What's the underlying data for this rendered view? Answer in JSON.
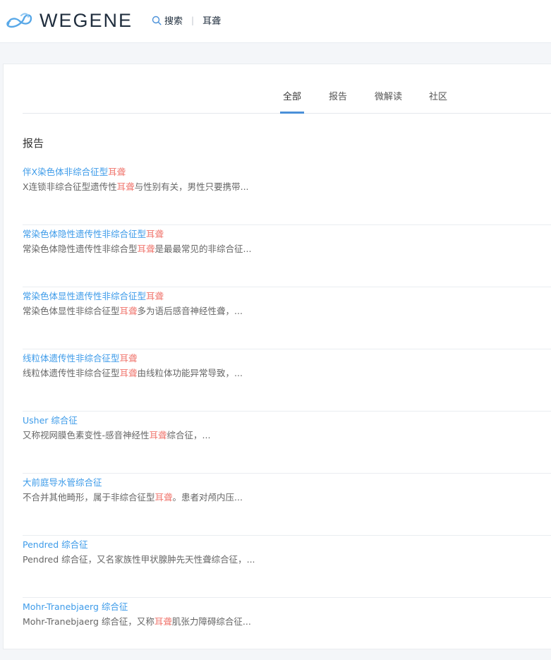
{
  "header": {
    "logo_text": "WEGENE",
    "search_label": "搜索",
    "separator": "|",
    "query": "耳聋"
  },
  "tabs": [
    {
      "label": "全部",
      "active": true
    },
    {
      "label": "报告",
      "active": false
    },
    {
      "label": "微解读",
      "active": false
    },
    {
      "label": "社区",
      "active": false
    }
  ],
  "section_title": "报告",
  "results": [
    {
      "title_pre": "伴X染色体非综合征型",
      "title_hl": "耳聋",
      "title_post": "",
      "desc_pre": "X连锁非综合征型遗传性",
      "desc_hl": "耳聋",
      "desc_post": "与性别有关，男性只要携带..."
    },
    {
      "title_pre": "常染色体隐性遗传性非综合征型",
      "title_hl": "耳聋",
      "title_post": "",
      "desc_pre": "常染色体隐性遗传性非综合型",
      "desc_hl": "耳聋",
      "desc_post": "是最最常见的非综合征..."
    },
    {
      "title_pre": "常染色体显性遗传性非综合征型",
      "title_hl": "耳聋",
      "title_post": "",
      "desc_pre": "常染色体显性非综合征型",
      "desc_hl": "耳聋",
      "desc_post": "多为语后感音神经性聋，..."
    },
    {
      "title_pre": "线粒体遗传性非综合征型",
      "title_hl": "耳聋",
      "title_post": "",
      "desc_pre": "线粒体遗传性非综合征型",
      "desc_hl": "耳聋",
      "desc_post": "由线粒体功能异常导致，..."
    },
    {
      "title_pre": "Usher 综合征",
      "title_hl": "",
      "title_post": "",
      "desc_pre": "又称视网膜色素变性-感音神经性",
      "desc_hl": "耳聋",
      "desc_post": "综合征，..."
    },
    {
      "title_pre": "大前庭导水管综合征",
      "title_hl": "",
      "title_post": "",
      "desc_pre": "不合并其他畸形，属于非综合征型",
      "desc_hl": "耳聋",
      "desc_post": "。患者对颅内压..."
    },
    {
      "title_pre": "Pendred 综合征",
      "title_hl": "",
      "title_post": "",
      "desc_pre": "Pendred 综合征，又名家族性甲状腺肿先天性聋综合征，...",
      "desc_hl": "",
      "desc_post": ""
    },
    {
      "title_pre": "Mohr-Tranebjaerg 综合征",
      "title_hl": "",
      "title_post": "",
      "desc_pre": "Mohr-Tranebjaerg 综合征，又称",
      "desc_hl": "耳聋",
      "desc_post": "肌张力障碍综合征..."
    }
  ],
  "colors": {
    "link": "#3d9be9",
    "highlight": "#f0776f",
    "tab_indicator": "#4a90d9"
  }
}
